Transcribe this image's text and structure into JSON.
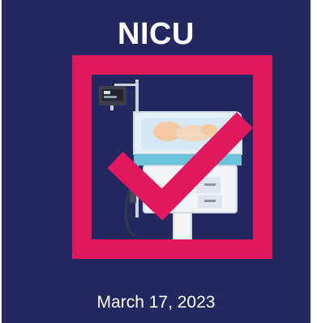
{
  "card": {
    "title": "NICU",
    "date": "March 17, 2023"
  },
  "icons": {
    "equipment": "nicu-incubator-icon",
    "check": "checkmark-icon",
    "frame": "square-frame-icon"
  },
  "colors": {
    "background": "#232861",
    "accent": "#e0185e",
    "text": "#ffffff"
  }
}
